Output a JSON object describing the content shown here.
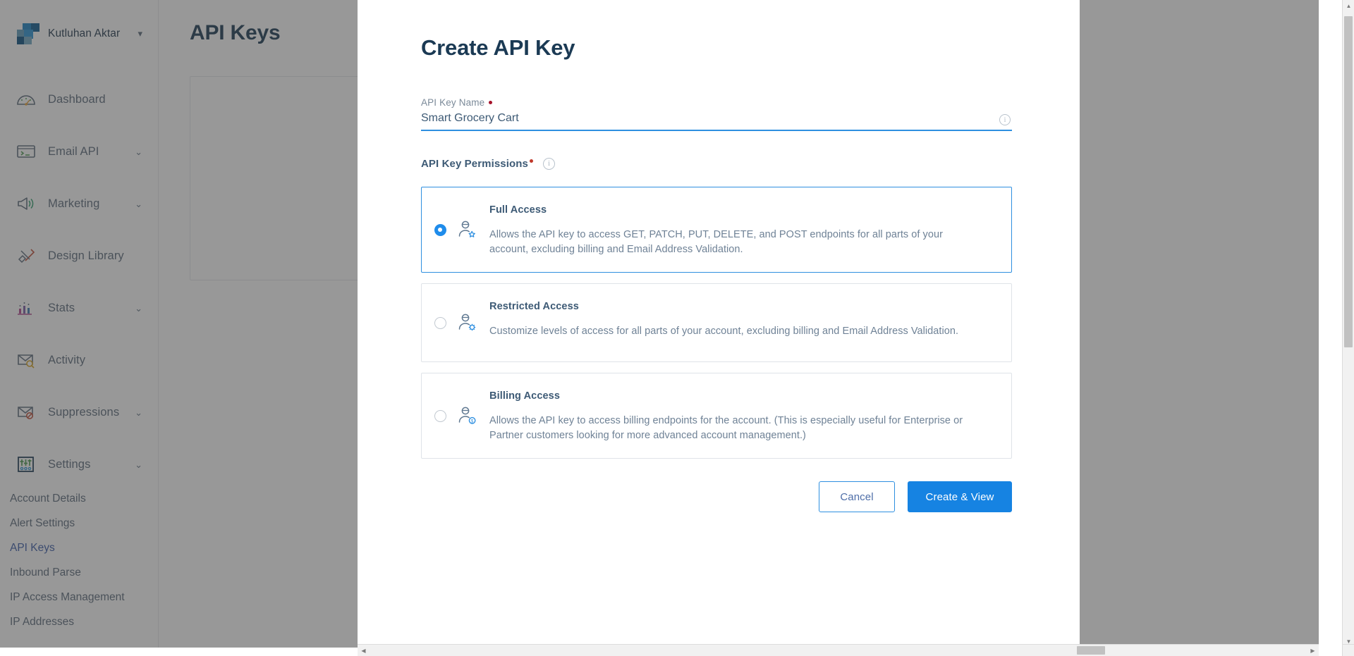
{
  "background": {
    "brand": {
      "name": "Kutluhan Aktar",
      "caret": "chevron-down-icon"
    },
    "nav": [
      {
        "label": "Dashboard",
        "icon": "gauge-icon",
        "caret": ""
      },
      {
        "label": "Email API",
        "icon": "terminal-icon",
        "caret": "⌄"
      },
      {
        "label": "Marketing",
        "icon": "megaphone-icon",
        "caret": "⌄"
      },
      {
        "label": "Design Library",
        "icon": "pencil-ruler-icon",
        "caret": ""
      },
      {
        "label": "Stats",
        "icon": "bar-chart-icon",
        "caret": "⌄"
      },
      {
        "label": "Activity",
        "icon": "envelope-search-icon",
        "caret": ""
      },
      {
        "label": "Suppressions",
        "icon": "envelope-block-icon",
        "caret": "⌄"
      },
      {
        "label": "Settings",
        "icon": "sliders-icon",
        "caret": "⌄"
      }
    ],
    "subnav": [
      {
        "label": "Account Details",
        "active": false
      },
      {
        "label": "Alert Settings",
        "active": false
      },
      {
        "label": "API Keys",
        "active": true
      },
      {
        "label": "Inbound Parse",
        "active": false
      },
      {
        "label": "IP Access Management",
        "active": false
      },
      {
        "label": "IP Addresses",
        "active": false
      }
    ],
    "page_title": "API Keys"
  },
  "modal": {
    "title": "Create API Key",
    "name_field": {
      "label": "API Key Name",
      "value": "Smart Grocery Cart",
      "placeholder": "",
      "required": true,
      "info_icon": "info-icon"
    },
    "permissions": {
      "title": "API Key Permissions",
      "required": true,
      "info_icon": "info-icon",
      "options": [
        {
          "id": "full-access",
          "name": "Full Access",
          "icon": "user-star-icon",
          "selected": true,
          "description": "Allows the API key to access GET, PATCH, PUT, DELETE, and POST endpoints for all parts of your account, excluding billing and Email Address Validation."
        },
        {
          "id": "restricted-access",
          "name": "Restricted Access",
          "icon": "user-gear-icon",
          "selected": false,
          "description": "Customize levels of access for all parts of your account, excluding billing and Email Address Validation."
        },
        {
          "id": "billing-access",
          "name": "Billing Access",
          "icon": "user-dollar-icon",
          "selected": false,
          "description": "Allows the API key to access billing endpoints for the account. (This is especially useful for Enterprise or Partner customers looking for more advanced account management.)"
        }
      ]
    },
    "actions": {
      "cancel": "Cancel",
      "submit": "Create & View"
    }
  },
  "colors": {
    "accent_blue": "#1683e2",
    "title_navy": "#1b3a54",
    "text_slate": "#6f8296",
    "required_red": "#a5122a",
    "link_blue": "#3b5ba9"
  }
}
